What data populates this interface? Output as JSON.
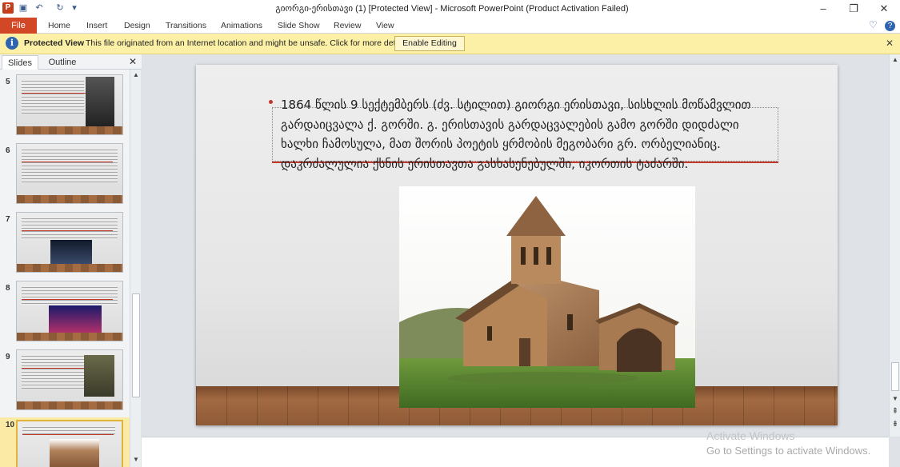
{
  "window": {
    "title": "გიორგი-ერისთავი (1) [Protected View]  -  Microsoft PowerPoint (Product Activation Failed)",
    "app_icon_letter": "P",
    "minimize": "–",
    "restore": "❐",
    "close": "✕"
  },
  "quick_access": {
    "save": "▣",
    "undo": "↶",
    "redo": "↻",
    "customize": "▾"
  },
  "ribbon": {
    "file_label": "File",
    "tabs": [
      "Home",
      "Insert",
      "Design",
      "Transitions",
      "Animations",
      "Slide Show",
      "Review",
      "View"
    ],
    "minimize_ribbon": "♡",
    "help": "?"
  },
  "protected_view": {
    "icon": "i",
    "title": "Protected View",
    "message": "This file originated from an Internet location and might be unsafe. Click for more details.",
    "button_label": "Enable Editing",
    "close": "✕"
  },
  "slides_pane": {
    "tabs": [
      "Slides",
      "Outline"
    ],
    "close": "✕",
    "thumbnails": [
      {
        "number": "5"
      },
      {
        "number": "6"
      },
      {
        "number": "7"
      },
      {
        "number": "8"
      },
      {
        "number": "9"
      },
      {
        "number": "10"
      }
    ]
  },
  "slide": {
    "bullet_text": "1864 წლის 9 სექტემბერს (ძვ. სტილით) გიორგი ერისთავი, სისხლის მოწამვლით გარდაიცვალა ქ. გორში. გ. ერისთავის გარდაცვალების გამო გორში დიდძალი ხალხი ჩამოსულა, მათ შორის პოეტის ყრმობის მეგობარი გრ. ორბელიანიც. დაკრძალულია ქსნის ერისთავთა გასხასენებულში, იკორთის ტაძარში."
  },
  "scroll": {
    "up": "▲",
    "down": "▼",
    "prev_slide": "⇞",
    "next_slide": "⇟"
  },
  "activation_watermark": {
    "line1": "Activate Windows",
    "line2": "Go to Settings to activate Windows."
  },
  "colors": {
    "file_tab": "#d24726",
    "protected_bar": "#fcf0a6",
    "bullet": "#c0392b"
  }
}
